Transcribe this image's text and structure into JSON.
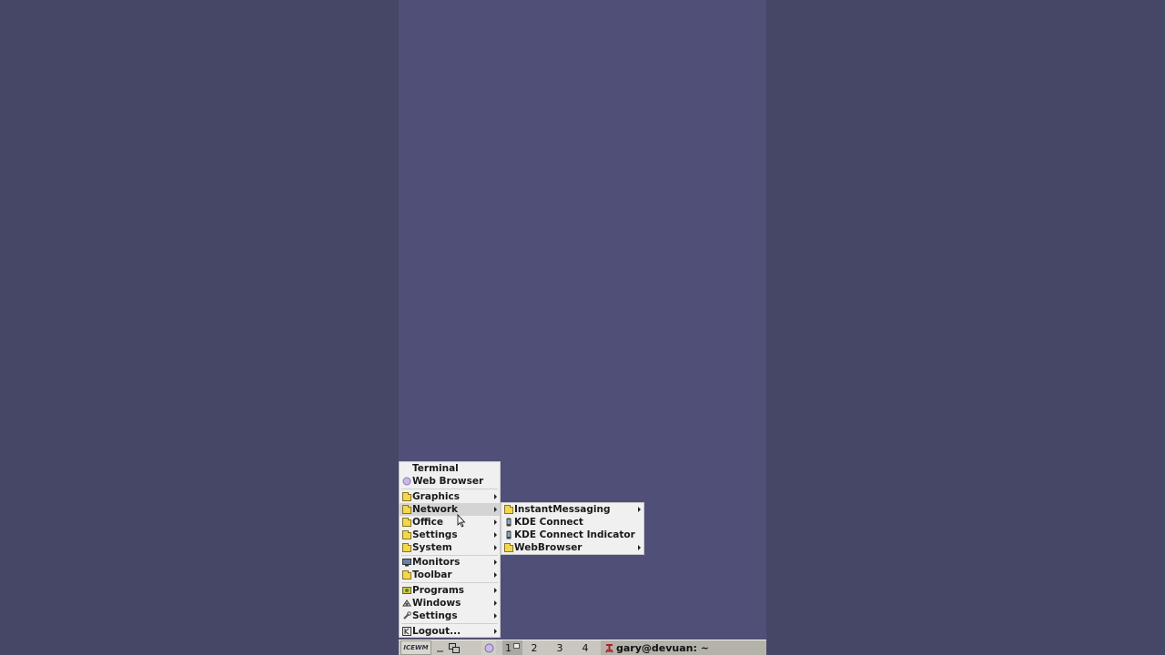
{
  "main_menu": {
    "items": [
      {
        "label": "Terminal",
        "icon": "none",
        "submenu": false
      },
      {
        "label": "Web Browser",
        "icon": "globe-icon",
        "submenu": false
      },
      {
        "label": "Graphics",
        "icon": "folder-icon",
        "submenu": true
      },
      {
        "label": "Network",
        "icon": "folder-icon",
        "submenu": true,
        "highlighted": true
      },
      {
        "label": "Office",
        "icon": "folder-icon",
        "submenu": true
      },
      {
        "label": "Settings",
        "icon": "folder-icon",
        "submenu": true
      },
      {
        "label": "System",
        "icon": "folder-icon",
        "submenu": true
      },
      {
        "label": "Monitors",
        "icon": "monitor-icon",
        "submenu": true
      },
      {
        "label": "Toolbar",
        "icon": "folder-icon",
        "submenu": true
      },
      {
        "label": "Programs",
        "icon": "programs-icon",
        "submenu": true
      },
      {
        "label": "Windows",
        "icon": "windows-icon",
        "submenu": true
      },
      {
        "label": "Settings",
        "icon": "wrench-icon",
        "submenu": true
      },
      {
        "label": "Logout...",
        "icon": "logout-icon",
        "submenu": true
      }
    ]
  },
  "network_submenu": {
    "items": [
      {
        "label": "InstantMessaging",
        "icon": "folder-icon",
        "submenu": true
      },
      {
        "label": "KDE Connect",
        "icon": "phone-icon",
        "submenu": false
      },
      {
        "label": "KDE Connect Indicator",
        "icon": "phone-icon",
        "submenu": false
      },
      {
        "label": "WebBrowser",
        "icon": "folder-icon",
        "submenu": true
      }
    ]
  },
  "taskbar": {
    "start_label": "ICEWM",
    "workspaces": [
      "1",
      "2",
      "3",
      "4"
    ],
    "active_workspace": "1",
    "task_title": "gary@devuan: ~"
  },
  "colors": {
    "desktop": "#504f77",
    "outer": "#464666",
    "menu_bg": "#f0f0f0",
    "taskbar": "#c8c6be"
  }
}
